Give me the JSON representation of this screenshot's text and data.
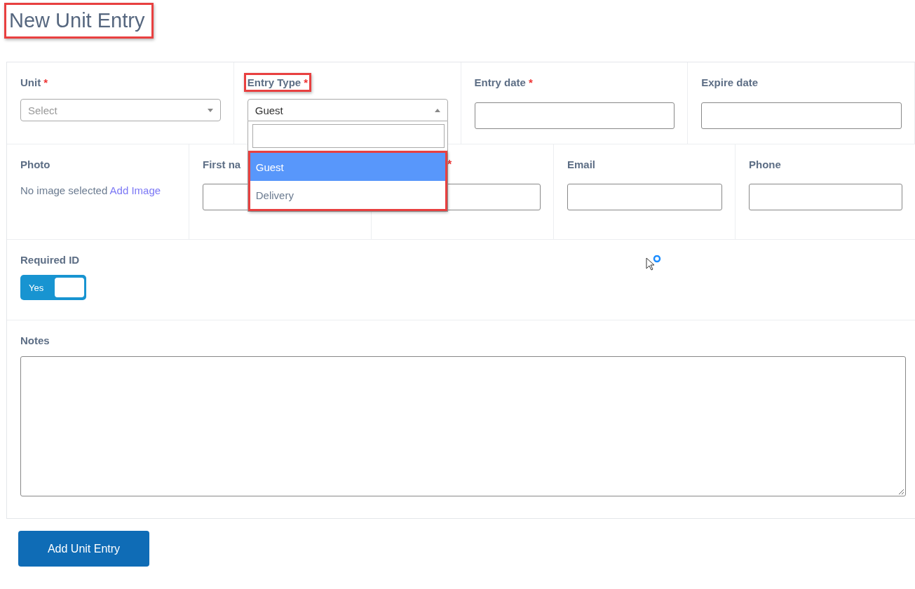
{
  "title": {
    "text": "New Unit Entry",
    "highlighted": true
  },
  "row_1": [
    {
      "kind": "select",
      "label": "Unit",
      "required_mark": "*",
      "placeholder": "Select",
      "highlighted": false
    },
    {
      "kind": "select_open",
      "label": "Entry Type",
      "required_mark": "*",
      "value": "Guest",
      "highlighted": true
    },
    {
      "kind": "text",
      "label": "Entry date",
      "required_mark": "*",
      "highlighted": false
    },
    {
      "kind": "text",
      "label": "Expire date",
      "highlighted": false
    }
  ],
  "dropdown": {
    "options_highlighted": true,
    "options": [
      {
        "label": "Guest",
        "selected": true
      },
      {
        "label": "Delivery",
        "selected": false
      }
    ]
  },
  "photo": {
    "label": "Photo",
    "status": "No image selected",
    "link": "Add Image"
  },
  "row_2": [
    {
      "label": "First na"
    },
    {
      "required_mark": "*"
    },
    {
      "label": "Email"
    },
    {
      "label": "Phone"
    }
  ],
  "required_id": {
    "label": "Required ID",
    "toggle_label": "Yes",
    "on": true
  },
  "notes": {
    "label": "Notes"
  },
  "submit_button": "Add Unit Entry"
}
